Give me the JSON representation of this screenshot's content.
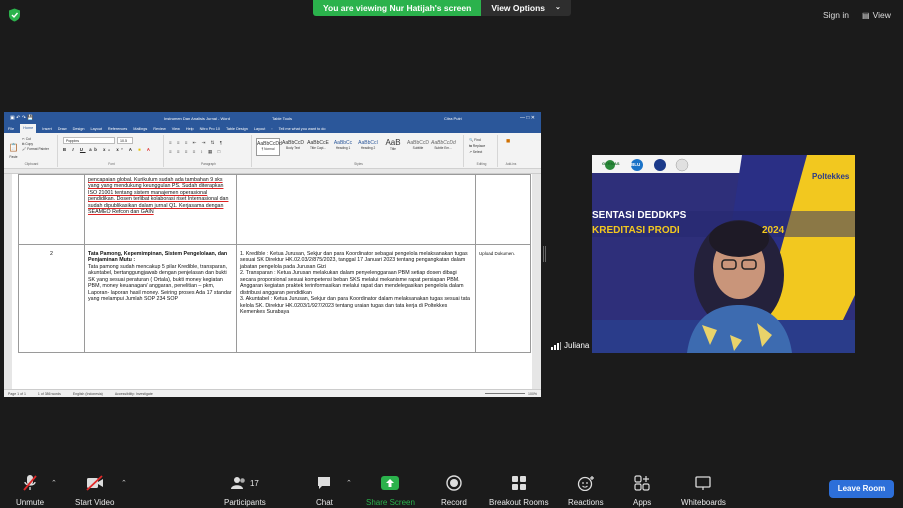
{
  "banner": {
    "viewing_text": "You are viewing Nur Hatijah's screen",
    "view_options": "View Options"
  },
  "top_right": {
    "sign_in": "Sign in",
    "view": "View"
  },
  "word": {
    "doc_title": "Instrumen Dan Analisis Jurnal - Word",
    "table_tools": "Table Tools",
    "user": "Citra Putri",
    "tabs": [
      "File",
      "Home",
      "Insert",
      "Draw",
      "Design",
      "Layout",
      "References",
      "Mailings",
      "Review",
      "View",
      "Help",
      "Nitro Pro 10",
      "Table Design",
      "Layout"
    ],
    "tell_me": "Tell me what you want to do",
    "font_name": "Poppins",
    "font_size": "10.5",
    "groups": [
      "Clipboard",
      "Font",
      "Paragraph",
      "Styles",
      "Editing",
      "Add-ins"
    ],
    "styles": [
      {
        "sample": "AaBbCcDd",
        "name": "¶ Normal"
      },
      {
        "sample": "AaBbCcD",
        "name": "Body Text"
      },
      {
        "sample": "AaBbCcE",
        "name": "Title Capi..."
      },
      {
        "sample": "AaBbCc",
        "name": "Heading 1"
      },
      {
        "sample": "AaBbCcI",
        "name": "Heading 2"
      },
      {
        "sample": "AaB",
        "name": "Title"
      },
      {
        "sample": "AaBbCcD",
        "name": "Subtitle"
      },
      {
        "sample": "AaBbCcDd",
        "name": "Subtle Em..."
      }
    ],
    "editing": [
      "Find",
      "Replace",
      "Select"
    ],
    "clipboard": [
      "Cut",
      "Copy",
      "Format Painter",
      "Paste"
    ],
    "status_left": "Page 1 of 1",
    "status_words": "1 of 386 words",
    "status_lang": "English (Indonesia)",
    "status_access": "Accessibility: Investigate",
    "zoom": "100%"
  },
  "table": {
    "row1": {
      "text": "pencapaian global. Kurikulum sudah ada tambahan 9 sks yang yang mendukung keunggulan PS. Sudah diterapkan ISO 21001 tentang sistem manajemen operasional pendidikan. Dosen terlibat kolaborasi riset Internasional dan sudah dipublikasikan dalam jurnal Q1. Kerjasama dengan SEAMEO Refcon dan GAIN"
    },
    "row2": {
      "number": "2",
      "heading": "Tata Pamong, Kepemimpinan, Sistem Pengelolaan, dan Penjaminan Mutu :",
      "description": "Tata pamong sudah mencakup 5 pilar Kredible, transparan, akuntabel, bertanggungjawab dengan penjelasan dan bukti SK yang sesuai peraturan ( Ortala), bukti money kegiatan PBM, money keuanagan/ anggaran, penelitian – pkm, Laporan- laporan hasil money. Seiring proses Ada 17 standar yang melampui Jumlah SOP 234 SOP",
      "evidence": "1. Kredible : Ketua Jurusan, Sekjur dan para Koordinator sebagai pengelola melaksanakan tugas sesuai SK Direktur HK.02.03/2/875/2023, tanggal 17 Januari 2023 tentang pengangkatan dalam jabatan pengelola pada Jurusan Gizi\n2. Transparan : Ketua Jurusan melakukan dalam penyelenggaraan PBM setiap dosen dibagi secara proporsional sesuai kompetensi beban SKS melalui mekanisme rapat persiapan PBM. Anggaran kegiatan praktek terinformasikan melalui rapat dan mendelegasikan pengelola dalam distribusi anggaran pendidikan\n3. Akuntabel : Ketua Jurusan, Sekjur dan para Koordinator dalam melaksanakan tugas sesuai tata kelola SK. Direktur HK.0203/1/927/2023 tentang uraian tugas dan tata kerja di Poltekkes Kemenkes Surabaya",
      "note": "Upload Dokumen."
    }
  },
  "video": {
    "participant_name": "Juliana",
    "banner_line1": "SENTASI DEDDKPS",
    "banner_line2": "KREDITASI PRODI",
    "banner_year": "2024",
    "logo_text": "Poltekkes",
    "logo_small": [
      "GERMAS",
      "BLU"
    ]
  },
  "toolbar": {
    "unmute": "Unmute",
    "start_video": "Start Video",
    "participants": "Participants",
    "participants_count": "17",
    "chat": "Chat",
    "share_screen": "Share Screen",
    "record": "Record",
    "breakout_rooms": "Breakout Rooms",
    "reactions": "Reactions",
    "apps": "Apps",
    "whiteboards": "Whiteboards",
    "leave": "Leave Room"
  },
  "colors": {
    "share_green": "#2bb24c",
    "leave_blue": "#2d6fd9",
    "word_blue": "#2b579a",
    "mic_off_red": "#e02828"
  }
}
